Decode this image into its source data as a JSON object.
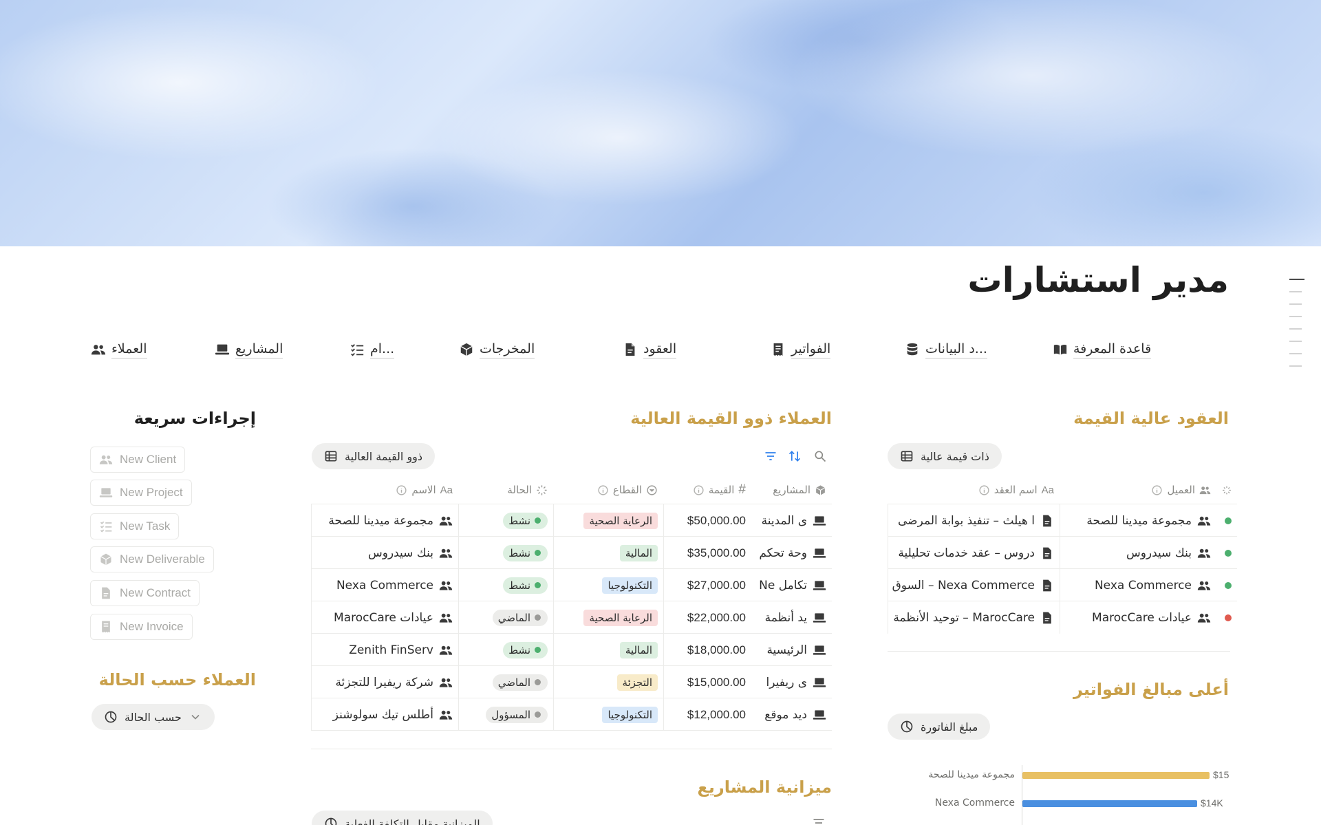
{
  "page": {
    "title": "مدير استشارات"
  },
  "nav": [
    {
      "label": "قاعدة المعرفة",
      "icon": "book-icon"
    },
    {
      "label": "...د البيانات",
      "icon": "database-icon"
    },
    {
      "label": "الفواتير",
      "icon": "receipt-icon"
    },
    {
      "label": "العقود",
      "icon": "document-icon"
    },
    {
      "label": "المخرجات",
      "icon": "package-icon"
    },
    {
      "label": "...ام",
      "icon": "checklist-icon"
    },
    {
      "label": "المشاريع",
      "icon": "laptop-icon"
    },
    {
      "label": "العملاء",
      "icon": "people-icon"
    }
  ],
  "quick_actions": {
    "title": "إجراءات سريعة",
    "buttons": [
      {
        "label": "New Client",
        "icon": "people-icon"
      },
      {
        "label": "New Project",
        "icon": "laptop-icon"
      },
      {
        "label": "New Task",
        "icon": "checklist-icon"
      },
      {
        "label": "New Deliverable",
        "icon": "package-icon"
      },
      {
        "label": "New Contract",
        "icon": "document-icon"
      },
      {
        "label": "New Invoice",
        "icon": "receipt-icon"
      }
    ]
  },
  "clients_by_status": {
    "title": "العملاء حسب الحالة",
    "view_label": "حسب الحالة"
  },
  "high_value_clients": {
    "title": "العملاء ذوو القيمة العالية",
    "view_label": "ذوو القيمة العالية",
    "columns": {
      "name": "الاسم",
      "status": "الحالة",
      "sector": "القطاع",
      "value": "القيمة",
      "projects": "المشاريع"
    },
    "rows": [
      {
        "name": "مجموعة ميدينا للصحة",
        "status": "نشط",
        "status_color": "#4caf6e",
        "status_bg": "#dcefe0",
        "sector": "الرعاية الصحية",
        "sector_bg": "#f9dcdc",
        "value": "$50,000.00",
        "project": "ى المدينة"
      },
      {
        "name": "بنك سيدروس",
        "status": "نشط",
        "status_color": "#4caf6e",
        "status_bg": "#dcefe0",
        "sector": "المالية",
        "sector_bg": "#dcefe0",
        "value": "$35,000.00",
        "project": "وحة تحكم"
      },
      {
        "name": "Nexa Commerce",
        "status": "نشط",
        "status_color": "#4caf6e",
        "status_bg": "#dcefe0",
        "sector": "التكنولوجيا",
        "sector_bg": "#d8e8f9",
        "value": "$27,000.00",
        "project": "تكامل Ne"
      },
      {
        "name": "عيادات MarocCare",
        "status": "الماضي",
        "status_color": "#9b9b98",
        "status_bg": "#ececea",
        "sector": "الرعاية الصحية",
        "sector_bg": "#f9dcdc",
        "value": "$22,000.00",
        "project": "يد أنظمة"
      },
      {
        "name": "Zenith FinServ",
        "status": "نشط",
        "status_color": "#4caf6e",
        "status_bg": "#dcefe0",
        "sector": "المالية",
        "sector_bg": "#dcefe0",
        "value": "$18,000.00",
        "project": "الرئيسية"
      },
      {
        "name": "شركة ريفيرا للتجزئة",
        "status": "الماضي",
        "status_color": "#9b9b98",
        "status_bg": "#ececea",
        "sector": "التجزئة",
        "sector_bg": "#f8ebc9",
        "value": "$15,000.00",
        "project": "ى ريفيرا"
      },
      {
        "name": "أطلس تيك سولوشنز",
        "status": "المسؤول",
        "status_color": "#9b9b98",
        "status_bg": "#ececea",
        "sector": "التكنولوجيا",
        "sector_bg": "#d8e8f9",
        "value": "$12,000.00",
        "project": "ديد موقع"
      }
    ]
  },
  "high_value_contracts": {
    "title": "العقود عالية القيمة",
    "view_label": "ذات قيمة عالية",
    "columns": {
      "contract_name": "اسم العقد",
      "client": "العميل"
    },
    "rows": [
      {
        "contract": "ا هيلث – تنفيذ بوابة المرضى",
        "client": "مجموعة ميدينا للصحة",
        "dot": "#4caf6e"
      },
      {
        "contract": "دروس – عقد خدمات تحليلية",
        "client": "بنك سيدروس",
        "dot": "#4caf6e"
      },
      {
        "contract": "Nexa Commerce – السوق",
        "client": "Nexa Commerce",
        "dot": "#4caf6e"
      },
      {
        "contract": "MarocCare – توحيد الأنظمة",
        "client": "عيادات MarocCare",
        "dot": "#e05a4f"
      }
    ]
  },
  "top_invoices": {
    "title": "أعلى مبالغ الفواتير",
    "view_label": "مبلغ الفاتورة"
  },
  "project_budget": {
    "title": "ميزانية المشاريع",
    "view_label": "الميزانية مقابل التكلفة الفعلية"
  },
  "chart_data": {
    "type": "bar",
    "orientation": "horizontal",
    "categories": [
      "مجموعة ميدينا للصحة",
      "Nexa Commerce"
    ],
    "values": [
      15,
      14
    ],
    "value_labels": [
      "$15",
      "$14K"
    ],
    "colors": [
      "#e8c063",
      "#4a8fe0"
    ]
  }
}
